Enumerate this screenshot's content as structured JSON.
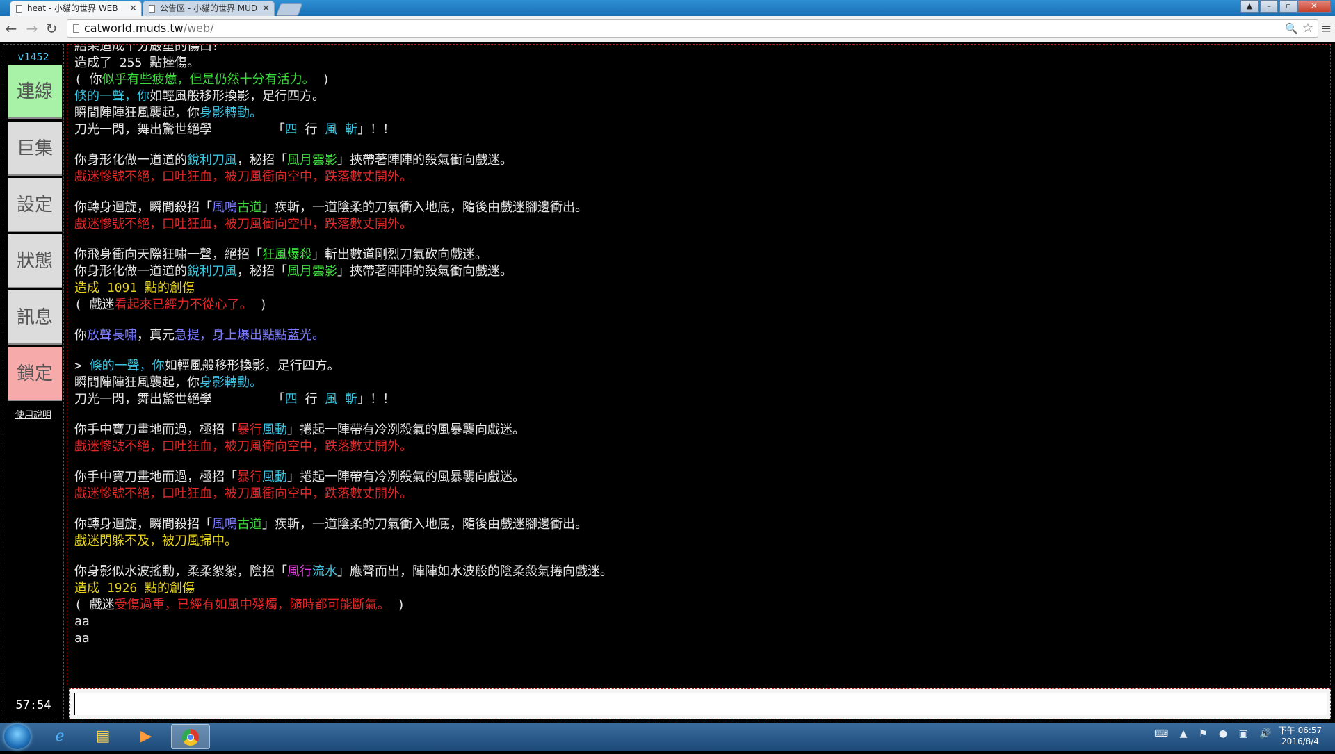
{
  "browser": {
    "tabs": [
      {
        "title": "heat - 小貓的世界 WEB"
      },
      {
        "title": "公告區 - 小貓的世界 MUD"
      }
    ],
    "url_host": "catworld.muds.tw",
    "url_path": "/web/"
  },
  "sidebar": {
    "version": "v1452",
    "buttons": [
      "連線",
      "巨集",
      "設定",
      "狀態",
      "訊息",
      "鎖定"
    ],
    "help": "使用說明",
    "timer": "57:54"
  },
  "output": {
    "lines": [
      [
        [
          "w",
          "結果造成十分嚴重的傷口！"
        ]
      ],
      [
        [
          "w",
          "造成了 255 點挫傷。"
        ]
      ],
      [
        [
          "w",
          "( 你"
        ],
        [
          "g",
          "似乎有些疲憊，但是仍然十分有活力。"
        ],
        [
          "w",
          " )"
        ]
      ],
      [
        [
          "c",
          "倏的一聲，你"
        ],
        [
          "w",
          "如輕風般移形換影，足行四方。"
        ]
      ],
      [
        [
          "w",
          "瞬間陣陣狂風襲起，你"
        ],
        [
          "c",
          "身影轉動。"
        ]
      ],
      [
        [
          "w",
          "刀光一閃，舞出驚世絕學        「"
        ],
        [
          "c",
          "四 "
        ],
        [
          "w",
          "行 "
        ],
        [
          "c",
          "風 斬"
        ],
        [
          "w",
          "」！！"
        ]
      ],
      [],
      [
        [
          "w",
          "你身形化做一道道的"
        ],
        [
          "c",
          "銳利刀風"
        ],
        [
          "w",
          "，秘招「"
        ],
        [
          "g",
          "風月雲影"
        ],
        [
          "w",
          "」挾帶著陣陣的殺氣衝向戲迷。"
        ]
      ],
      [
        [
          "r",
          "戲迷慘號不絕，口吐狂血，被刀風衝向空中，跌落數丈開外。"
        ]
      ],
      [],
      [
        [
          "w",
          "你轉身迴旋，瞬間殺招「"
        ],
        [
          "b",
          "風鳴"
        ],
        [
          "g",
          "古道"
        ],
        [
          "w",
          "」疾斬，一道陰柔的刀氣衝入地底，隨後由戲迷腳邊衝出。"
        ]
      ],
      [
        [
          "r",
          "戲迷慘號不絕，口吐狂血，被刀風衝向空中，跌落數丈開外。"
        ]
      ],
      [],
      [
        [
          "w",
          "你飛身衝向天際狂嘯一聲，絕招「"
        ],
        [
          "g",
          "狂風爆殺"
        ],
        [
          "w",
          "」斬出數道剛烈刀氣砍向戲迷。"
        ]
      ],
      [
        [
          "w",
          "你身形化做一道道的"
        ],
        [
          "c",
          "銳利刀風"
        ],
        [
          "w",
          "，秘招「"
        ],
        [
          "g",
          "風月雲影"
        ],
        [
          "w",
          "」挾帶著陣陣的殺氣衝向戲迷。"
        ]
      ],
      [
        [
          "y",
          "造成 1091 點的創傷"
        ]
      ],
      [
        [
          "w",
          "( 戲迷"
        ],
        [
          "r",
          "看起來已經力不從心了。"
        ],
        [
          "w",
          " )"
        ]
      ],
      [],
      [
        [
          "w",
          "你"
        ],
        [
          "b",
          "放聲長嘯"
        ],
        [
          "w",
          "，真元"
        ],
        [
          "b",
          "急提，身上爆出點點藍光。"
        ]
      ],
      [],
      [
        [
          "w",
          "> "
        ],
        [
          "c",
          "倏的一聲，你"
        ],
        [
          "w",
          "如輕風般移形換影，足行四方。"
        ]
      ],
      [
        [
          "w",
          "瞬間陣陣狂風襲起，你"
        ],
        [
          "c",
          "身影轉動。"
        ]
      ],
      [
        [
          "w",
          "刀光一閃，舞出驚世絕學        「"
        ],
        [
          "c",
          "四 "
        ],
        [
          "w",
          "行 "
        ],
        [
          "c",
          "風 斬"
        ],
        [
          "w",
          "」！！"
        ]
      ],
      [],
      [
        [
          "w",
          "你手中寶刀畫地而過，極招「"
        ],
        [
          "r",
          "暴行"
        ],
        [
          "c",
          "風動"
        ],
        [
          "w",
          "」捲起一陣帶有冷冽殺氣的風暴襲向戲迷。"
        ]
      ],
      [
        [
          "r",
          "戲迷慘號不絕，口吐狂血，被刀風衝向空中，跌落數丈開外。"
        ]
      ],
      [],
      [
        [
          "w",
          "你手中寶刀畫地而過，極招「"
        ],
        [
          "r",
          "暴行"
        ],
        [
          "c",
          "風動"
        ],
        [
          "w",
          "」捲起一陣帶有冷冽殺氣的風暴襲向戲迷。"
        ]
      ],
      [
        [
          "r",
          "戲迷慘號不絕，口吐狂血，被刀風衝向空中，跌落數丈開外。"
        ]
      ],
      [],
      [
        [
          "w",
          "你轉身迴旋，瞬間殺招「"
        ],
        [
          "b",
          "風鳴"
        ],
        [
          "g",
          "古道"
        ],
        [
          "w",
          "」疾斬，一道陰柔的刀氣衝入地底，隨後由戲迷腳邊衝出。"
        ]
      ],
      [
        [
          "y",
          "戲迷閃躲不及，被刀風掃中。"
        ]
      ],
      [],
      [
        [
          "w",
          "你身影似水波搖動，柔柔絮絮，陰招「"
        ],
        [
          "m",
          "風行"
        ],
        [
          "c",
          "流水"
        ],
        [
          "w",
          "」應聲而出，陣陣如水波般的陰柔殺氣捲向戲迷。"
        ]
      ],
      [
        [
          "y",
          "造成 1926 點的創傷"
        ]
      ],
      [
        [
          "w",
          "( 戲迷"
        ],
        [
          "r",
          "受傷過重，已經有如風中殘燭，隨時都可能斷氣。"
        ],
        [
          "w",
          " )"
        ]
      ],
      [
        [
          "w",
          "aa"
        ]
      ],
      [
        [
          "w",
          "aa"
        ]
      ]
    ]
  },
  "input": {
    "placeholder": ""
  },
  "taskbar": {
    "clock_time": "下午 06:57",
    "clock_date": "2016/8/4"
  }
}
